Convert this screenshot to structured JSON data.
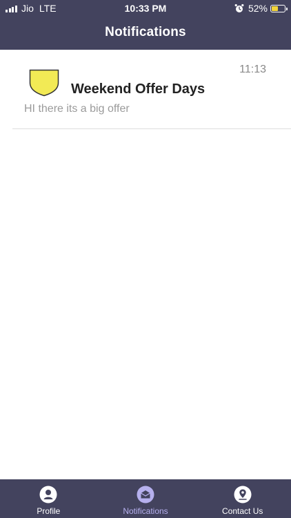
{
  "status_bar": {
    "carrier": "Jio",
    "network": "LTE",
    "time": "10:33 PM",
    "battery_percent": "52%",
    "battery_level": 0.52,
    "battery_color": "#f2d43b",
    "icons": [
      "signal-icon",
      "alarm-icon",
      "battery-icon"
    ]
  },
  "header": {
    "title": "Notifications",
    "background": "#43435e"
  },
  "notifications": [
    {
      "icon": "badge-icon",
      "icon_color": "#f2ea55",
      "title": "Weekend Offer Days",
      "message": "HI there its a big offer",
      "time": "11:13"
    }
  ],
  "tab_bar": {
    "background": "#43435e",
    "active_color": "#b6b0ee",
    "tabs": [
      {
        "label": "Profile",
        "icon": "profile-icon",
        "active": false
      },
      {
        "label": "Notifications",
        "icon": "notifications-icon",
        "active": true
      },
      {
        "label": "Contact Us",
        "icon": "contact-icon",
        "active": false
      }
    ]
  }
}
